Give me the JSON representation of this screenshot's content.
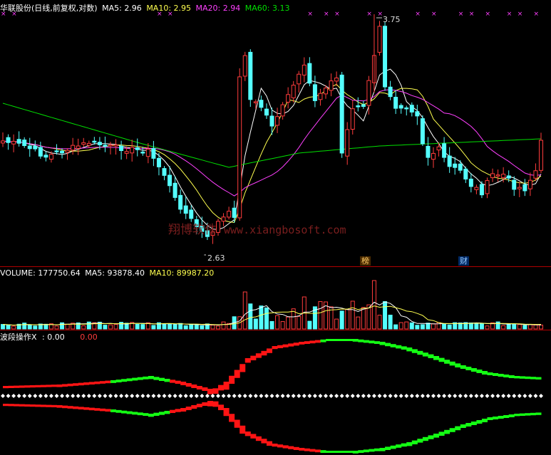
{
  "colors": {
    "up": "#ff3c3c",
    "down": "#54ffff",
    "ma5": "#ffffff",
    "ma10": "#ffff4f",
    "ma20": "#ff40ff",
    "ma60": "#00e000",
    "separator": "#b00000",
    "oscillator_red": "#ff1414",
    "oscillator_green": "#14ff14",
    "white_dots": "#ffffff"
  },
  "price_panel": {
    "stock_name": "华联股份(日线,前复权,对数)",
    "ma5_label": "MA5:",
    "ma5_value": "2.96",
    "ma10_label": "MA10:",
    "ma10_value": "2.95",
    "ma20_label": "MA20:",
    "ma20_value": "2.94",
    "ma60_label": "MA60:",
    "ma60_value": "3.13",
    "high_annotation": "3.75",
    "low_annotation": "2.63",
    "badge_bang": "榜",
    "badge_cai": "财"
  },
  "volume_panel": {
    "volume_label": "VOLUME:",
    "volume_value": "177750.64",
    "ma5_label": "MA5:",
    "ma5_value": "93878.40",
    "ma10_label": "MA10:",
    "ma10_value": "89987.20"
  },
  "oscillator_panel": {
    "name": "波段操作X",
    "value1": ": 0.00",
    "value2": "0.00"
  },
  "watermark": {
    "brand": "翔博软件",
    "url": "www.xiangbosoft.com"
  },
  "chart_data": [
    {
      "type": "candlestick",
      "scale": "log",
      "ylim": [
        2.6,
        3.8
      ],
      "bars_shown": 101,
      "price_high": 3.75,
      "price_low": 2.63,
      "moving_averages": [
        {
          "name": "MA5",
          "last": 2.96
        },
        {
          "name": "MA10",
          "last": 2.95
        },
        {
          "name": "MA20",
          "last": 2.94
        },
        {
          "name": "MA60",
          "last": 3.13
        }
      ]
    },
    {
      "type": "bar",
      "name": "VOLUME",
      "last": 177750.64,
      "moving_averages": [
        {
          "name": "MA5",
          "last": 93878.4
        },
        {
          "name": "MA10",
          "last": 89987.2
        }
      ]
    },
    {
      "type": "area",
      "name": "波段操作X",
      "values": [
        0.0,
        0.0
      ]
    }
  ]
}
